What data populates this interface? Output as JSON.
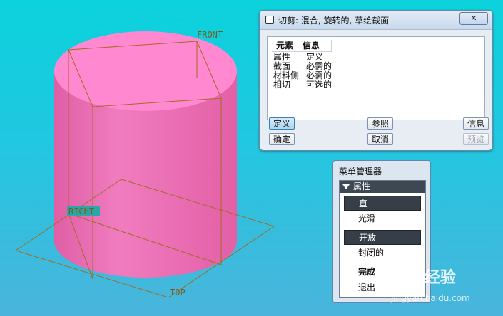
{
  "viewport": {
    "labels": {
      "front": "FRONT",
      "right": "RIGHT",
      "top": "TOP"
    },
    "colors": {
      "cylinder": "#ff86cf",
      "cylinder_side": "#e96aae",
      "planes": "#b07a25"
    }
  },
  "dialog": {
    "title": "切剪: 混合, 旋转的, 草绘截面",
    "close_label": "✕",
    "columns": [
      "元素",
      "信息"
    ],
    "rows": [
      [
        "属性",
        "定义"
      ],
      [
        "截面",
        "必需的"
      ],
      [
        "材料侧",
        "必需的"
      ],
      [
        "相切",
        "可选的"
      ]
    ],
    "buttons": {
      "define": "定义",
      "refs": "参照",
      "info": "信息",
      "ok": "确定",
      "cancel": "取消",
      "preview": "预览"
    }
  },
  "menu_manager": {
    "title": "菜单管理器",
    "section": "属性",
    "items": [
      "直",
      "光滑",
      "开放",
      "封闭的",
      "完成",
      "退出"
    ]
  },
  "watermark": {
    "logo": "Bai 经验",
    "url": "jingyan.baidu.com"
  }
}
